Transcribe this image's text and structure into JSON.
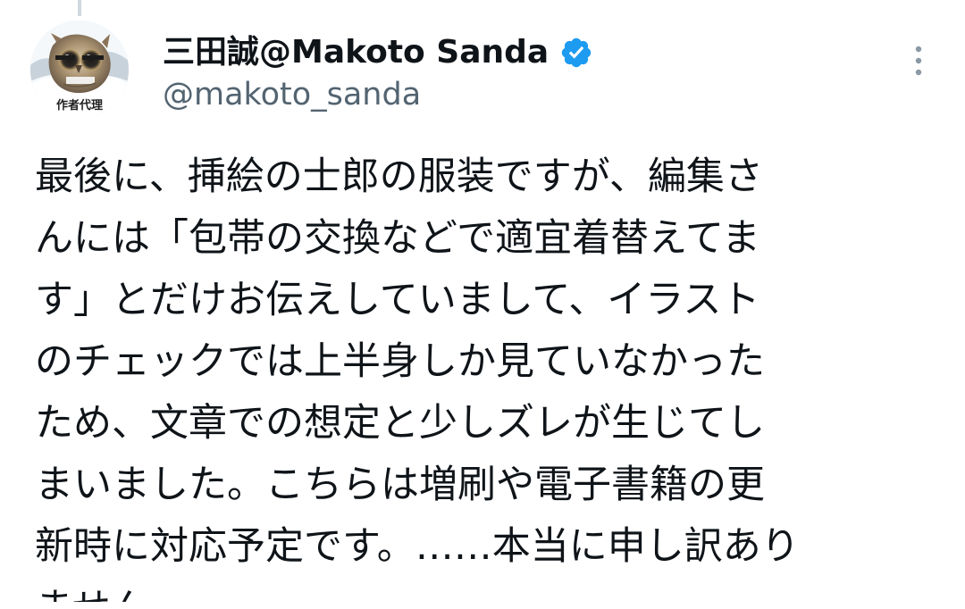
{
  "colors": {
    "background": "#ffffff",
    "text_primary": "#0f1419",
    "text_secondary": "#536471",
    "verified_badge": "#1d9bf0",
    "icon_gray": "#8b98a5"
  },
  "post": {
    "author": {
      "display_name": "三田誠@Makoto Sanda",
      "handle": "@makoto_sanda",
      "verified_icon_name": "verified-badge-icon",
      "avatar_label": "作者代理"
    },
    "menu_icon_name": "more-options-icon",
    "body_lines": [
      "最後に、挿絵の士郎の服装ですが、編集さ",
      "んには「包帯の交換などで適宜着替えてま",
      "す」とだけお伝えしていまして、イラスト",
      "のチェックでは上半身しか見ていなかった",
      "ため、文章での想定と少しズレが生じてし",
      "まいました。こちらは増刷や電子書籍の更",
      "新時に対応予定です。……本当に申し訳あり",
      "ません。"
    ]
  }
}
